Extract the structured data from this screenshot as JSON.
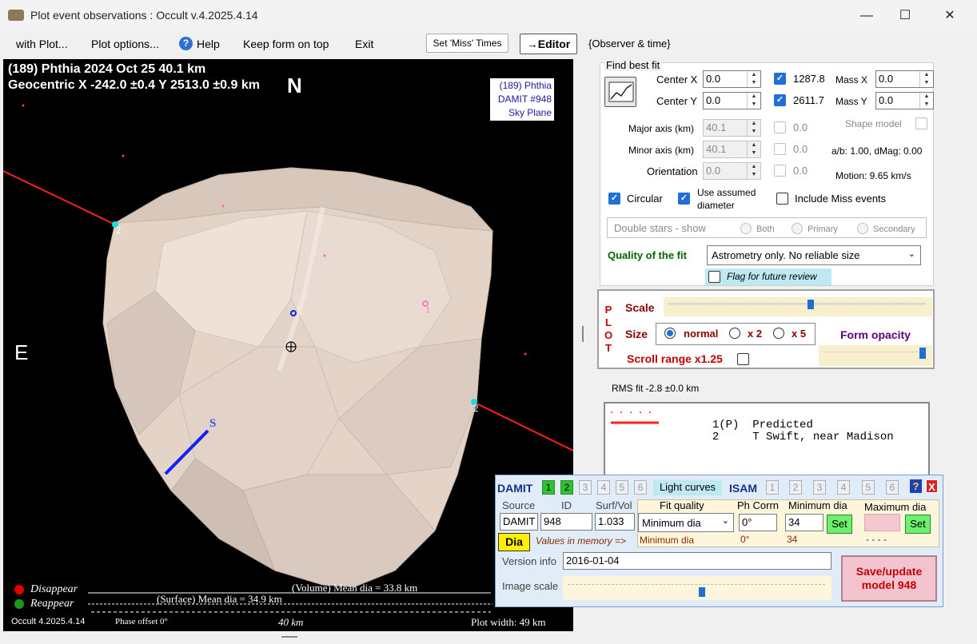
{
  "window": {
    "title": "Plot event observations : Occult v.4.2025.4.14",
    "controls": [
      "—",
      "☐",
      "✕"
    ]
  },
  "menu": {
    "with_plot": "with Plot...",
    "plot_options": "Plot options...",
    "help": "Help",
    "keep_on_top": "Keep form on top",
    "exit": "Exit",
    "set_miss_times": "Set 'Miss' Times",
    "editor": "→Editor",
    "observer_time": "{Observer & time}"
  },
  "plot": {
    "title_line1": "(189) Phthia  2024 Oct 25  40.1 km",
    "title_line2": "Geocentric  X  -242.0 ±0.4  Y 2513.0 ±0.9 km",
    "north": "N",
    "east": "E",
    "legend_box": [
      "(189) Phthia",
      "DAMIT #948",
      "Sky Plane"
    ],
    "chord_label_1": "1",
    "chord_label_2a": "2",
    "chord_label_2b": "2",
    "south_label": "S",
    "disappear": "Disappear",
    "reappear": "Reappear",
    "volume_mean": "(Volume) Mean dia = 33.8 km",
    "surface_mean": "(Surface) Mean dia = 34.9 km",
    "version": "Occult 4.2025.4.14",
    "phase_offset": "Phase offset 0°",
    "scale_km": "40 km",
    "plot_width": "Plot width: 49 km",
    "colors": {
      "disappear": "#e00000",
      "reappear": "#1a9a1a",
      "chord": "#ff2020",
      "shape": "#e8d8cc"
    }
  },
  "fit": {
    "find_best_fit": "Find best fit",
    "center_x_label": "Center X",
    "center_x": "0.0",
    "center_y_label": "Center Y",
    "center_y": "0.0",
    "cx_check_value": "1287.8",
    "cy_check_value": "2611.7",
    "mass_x_label": "Mass X",
    "mass_x": "0.0",
    "mass_y_label": "Mass Y",
    "mass_y": "0.0",
    "major_axis_label": "Major axis (km)",
    "major_axis": "40.1",
    "major_check": "0.0",
    "minor_axis_label": "Minor axis (km)",
    "minor_axis": "40.1",
    "minor_check": "0.0",
    "orientation_label": "Orientation",
    "orientation": "0.0",
    "orient_check": "0.0",
    "shape_model": "Shape model",
    "ab_dmag": "a/b: 1.00, dMag: 0.00",
    "motion": "Motion: 9.65 km/s",
    "circular": "Circular",
    "use_assumed_1": "Use assumed",
    "use_assumed_2": "diameter",
    "include_miss": "Include Miss events",
    "double_stars": "Double stars - show",
    "both": "Both",
    "primary": "Primary",
    "secondary": "Secondary",
    "quality_label": "Quality of the fit",
    "quality_value": "Astrometry only. No reliable size",
    "flag_review": "Flag for future review"
  },
  "plotctl": {
    "plot_letters": [
      "P",
      "L",
      "O",
      "T"
    ],
    "scale": "Scale",
    "size": "Size",
    "normal": "normal",
    "x2": "x 2",
    "x5": "x 5",
    "form_opacity": "Form opacity",
    "scroll_range": "Scroll range x1.25",
    "rms_fit": "RMS fit -2.8 ±0.0 km"
  },
  "chords": [
    {
      "num": "1(P)",
      "name": "Predicted"
    },
    {
      "num": "2",
      "name": "T Swift, near Madison"
    }
  ],
  "damit": {
    "title": "DAMIT",
    "nums": [
      "1",
      "2",
      "3",
      "4",
      "5",
      "6"
    ],
    "light_curves": "Light curves",
    "isam": "ISAM",
    "isam_nums": [
      "1",
      "2",
      "3",
      "4",
      "5",
      "6"
    ],
    "help": "?",
    "close": "X",
    "source_label": "Source",
    "id_label": "ID",
    "surf_vol_label": "Surf/Vol",
    "source": "DAMIT",
    "id": "948",
    "surf_vol": "1.033",
    "fit_quality_label": "Fit quality",
    "fit_quality": "Minimum dia",
    "fit_quality_mem": "Minimum dia",
    "ph_corr_label": "Ph Corrn",
    "ph_corr": "0°",
    "ph_corr_mem": "0°",
    "min_dia_label": "Minimum dia",
    "min_dia": "34",
    "min_dia_mem": "34",
    "max_dia_label": "Maximum dia",
    "max_dia": "",
    "max_dia_mem": "- - - -",
    "set": "Set",
    "dia": "Dia",
    "values_memory": "Values in memory =>",
    "version_label": "Version info",
    "version": "2016-01-04",
    "image_scale_label": "Image scale",
    "save": "Save/update model 948"
  }
}
